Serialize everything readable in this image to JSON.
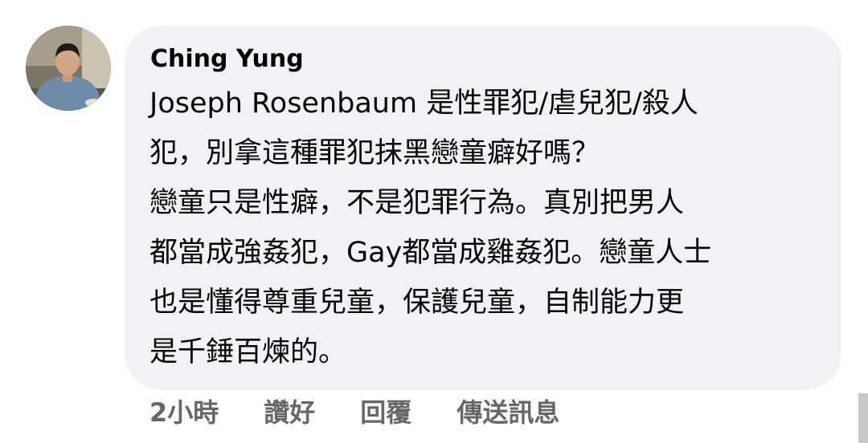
{
  "comment": {
    "author": "Ching Yung",
    "lines": [
      "Joseph Rosenbaum 是性罪犯/虐兒犯/殺人",
      "犯，別拿這種罪犯抹黑戀童癖好嗎？",
      "戀童只是性癖，不是犯罪行為。真別把男人",
      "都當成強姦犯，Gay都當成雞姦犯。戀童人士",
      "也是懂得尊重兒童，保護兒童，自制能力更",
      "是千錘百煉的。"
    ],
    "avatar_icon": "profile-photo"
  },
  "actions": {
    "time": "2小時",
    "like": "讚好",
    "reply": "回覆",
    "message": "傳送訊息"
  },
  "colors": {
    "bubble_bg": "#f0f2f5",
    "text": "#050505",
    "secondary_text": "#65676b"
  }
}
